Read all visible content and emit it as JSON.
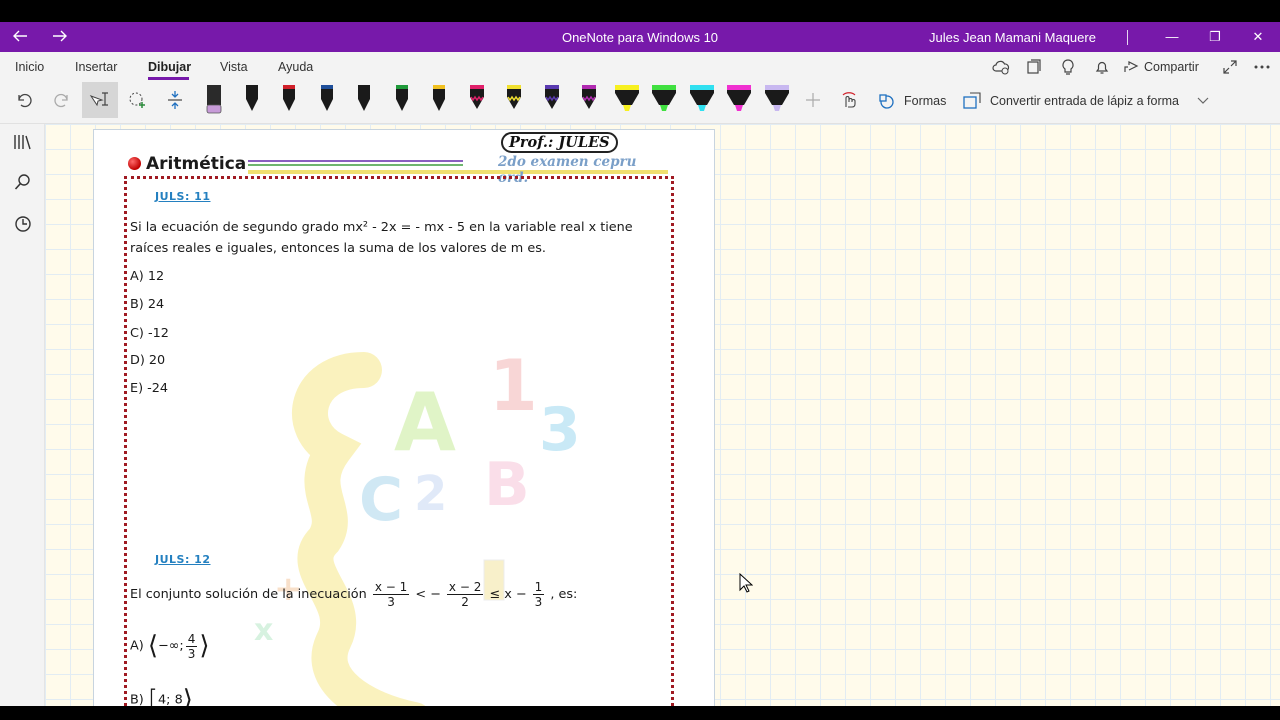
{
  "window": {
    "title": "OneNote para Windows 10",
    "user": "Jules Jean Mamani Maquere",
    "back_icon": "arrow-left-icon",
    "forward_icon": "arrow-right-icon",
    "minimize_glyph": "—",
    "restore_glyph": "❐",
    "close_glyph": "✕"
  },
  "ribbon": {
    "tabs": [
      {
        "label": "Inicio"
      },
      {
        "label": "Insertar"
      },
      {
        "label": "Dibujar",
        "active": true
      },
      {
        "label": "Vista"
      },
      {
        "label": "Ayuda"
      }
    ],
    "share_label": "Compartir",
    "shapes_label": "Formas",
    "convert_label": "Convertir entrada de lápiz a forma",
    "pens": [
      {
        "type": "marker",
        "color": "#2a2a2a",
        "tip": "#c79bd8"
      },
      {
        "type": "pen",
        "color": "#1a1a1a",
        "tip": "#1a1a1a"
      },
      {
        "type": "pen",
        "color": "#1a1a1a",
        "tip": "#d0202a"
      },
      {
        "type": "pen",
        "color": "#1a1a1a",
        "tip": "#1f4f9a"
      },
      {
        "type": "pen",
        "color": "#1a1a1a",
        "tip": "#1a1a1a"
      },
      {
        "type": "pen",
        "color": "#1a1a1a",
        "tip": "#1f9a3a"
      },
      {
        "type": "pen",
        "color": "#1a1a1a",
        "tip": "#f0c020"
      },
      {
        "type": "pencil",
        "color": "#1a1a1a",
        "tip": "#e0206a"
      },
      {
        "type": "pencil",
        "color": "#1a1a1a",
        "tip": "#f0e030"
      },
      {
        "type": "pencil",
        "color": "#1a1a1a",
        "tip": "#5a3ab0"
      },
      {
        "type": "pencil",
        "color": "#1a1a1a",
        "tip": "#b02ab0"
      },
      {
        "type": "highlighter",
        "color": "#1a1a1a",
        "tip": "#f7f020"
      },
      {
        "type": "highlighter",
        "color": "#1a1a1a",
        "tip": "#40e040"
      },
      {
        "type": "highlighter",
        "color": "#1a1a1a",
        "tip": "#30e0f0"
      },
      {
        "type": "highlighter",
        "color": "#1a1a1a",
        "tip": "#f030d0"
      },
      {
        "type": "highlighter",
        "color": "#1a1a1a",
        "tip": "#c8b8f0"
      }
    ]
  },
  "page": {
    "header_title": "Aritmética",
    "prof_label": "Prof.: JULES",
    "exam_label": "2do examen cepru ord.",
    "q1": {
      "tag": "JULS: 11",
      "line1": "Si la ecuación de segundo grado  mx² - 2x = - mx - 5  en la variable real x tiene",
      "line2": "raíces reales e iguales, entonces la suma de los valores de m es.",
      "options": [
        "A) 12",
        "B) 24",
        "C) -12",
        "D) 20",
        "E) -24"
      ]
    },
    "q2": {
      "tag": "JULS: 12",
      "prefix": "El conjunto solución de la inecuación",
      "f1_num": "x − 1",
      "f1_den": "3",
      "lt": "< −",
      "f2_num": "x − 2",
      "f2_den": "2",
      "le": "≤ x −",
      "f3_num": "1",
      "f3_den": "3",
      "suffix": ", es:",
      "optA_label": "A)",
      "optA_lower": "−∞;",
      "optA_num": "4",
      "optA_den": "3",
      "optB_label": "B)",
      "optB_num1": "4",
      "optB_num2": "8"
    }
  },
  "colors": {
    "titlebar": "#7719aa",
    "accent": "#7719aa",
    "tag": "#2480c0",
    "box_border": "#a01a22"
  }
}
